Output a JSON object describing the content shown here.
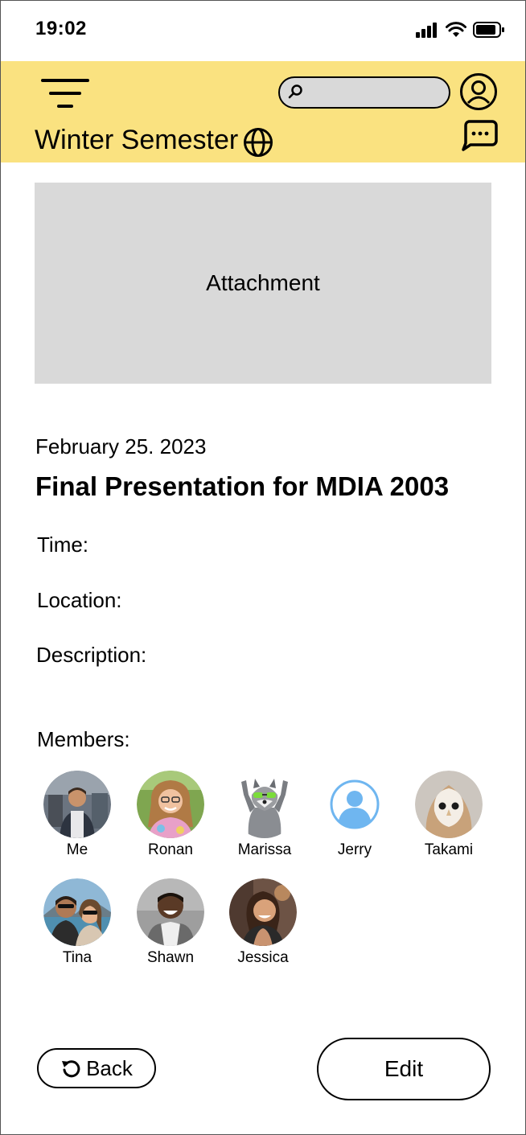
{
  "status_bar": {
    "time": "19:02"
  },
  "header": {
    "title": "Winter Semester",
    "search": {
      "placeholder": ""
    }
  },
  "attachment": {
    "label": "Attachment"
  },
  "event": {
    "date": "February 25. 2023",
    "title": "Final Presentation for MDIA 2003",
    "time_label": "Time:",
    "location_label": "Location:",
    "description_label": "Description:",
    "members_label": "Members:"
  },
  "members": [
    {
      "name": "Me"
    },
    {
      "name": "Ronan"
    },
    {
      "name": "Marissa"
    },
    {
      "name": "Jerry"
    },
    {
      "name": "Takami"
    },
    {
      "name": "Tina"
    },
    {
      "name": "Shawn"
    },
    {
      "name": "Jessica"
    }
  ],
  "actions": {
    "back_label": "Back",
    "edit_label": "Edit"
  },
  "colors": {
    "header_bg": "#fae280",
    "placeholder_gray": "#d9d9d9",
    "default_avatar": "#6fb6f0"
  }
}
